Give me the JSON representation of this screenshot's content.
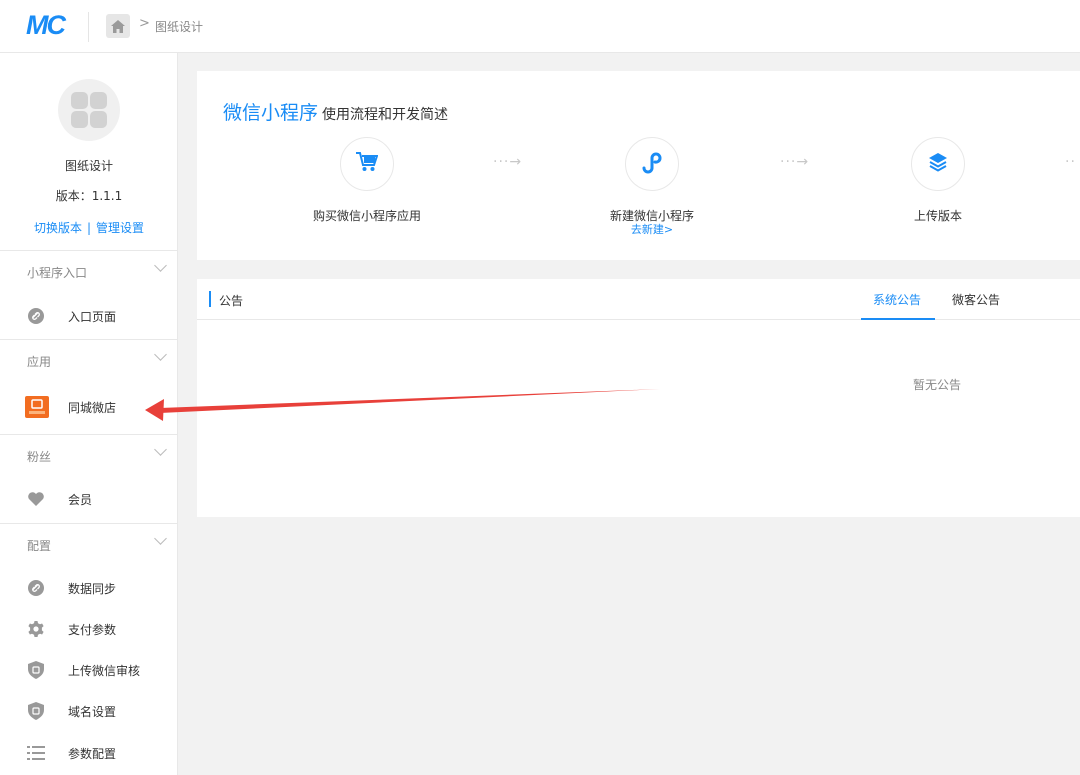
{
  "topbar": {
    "logo": "MC",
    "breadcrumb_sep": ">",
    "breadcrumb_current": "图纸设计"
  },
  "sidebar": {
    "app_name": "图纸设计",
    "version": "版本：1.1.1",
    "switch_version": "切换版本",
    "link_divider": "|",
    "manage_settings": "管理设置",
    "sections": [
      {
        "title": "小程序入口",
        "items": [
          {
            "label": "入口页面",
            "icon": "link-icon"
          }
        ]
      },
      {
        "title": "应用",
        "items": [
          {
            "label": "同城微店",
            "icon": "city-shop-app-icon"
          }
        ]
      },
      {
        "title": "粉丝",
        "items": [
          {
            "label": "会员",
            "icon": "heart-icon"
          }
        ]
      },
      {
        "title": "配置",
        "items": [
          {
            "label": "数据同步",
            "icon": "link-icon"
          },
          {
            "label": "支付参数",
            "icon": "gear-icon"
          },
          {
            "label": "上传微信审核",
            "icon": "shield-icon"
          },
          {
            "label": "域名设置",
            "icon": "shield-icon"
          },
          {
            "label": "参数配置",
            "icon": "list-icon"
          }
        ]
      }
    ]
  },
  "flow": {
    "title": "微信小程序",
    "subtitle": "使用流程和开发简述",
    "steps": [
      {
        "label": "购买微信小程序应用",
        "icon": "cart-icon"
      },
      {
        "label": "新建微信小程序",
        "link": "去新建>",
        "icon": "mini-program-icon"
      },
      {
        "label": "上传版本",
        "icon": "layers-icon"
      }
    ]
  },
  "notice": {
    "title": "公告",
    "tabs": [
      "系统公告",
      "微客公告"
    ],
    "active_tab": 0,
    "empty": "暂无公告"
  },
  "colors": {
    "accent": "#1a8cf5",
    "annotation_arrow": "#e8403a",
    "app_icon": "#f26d21"
  }
}
